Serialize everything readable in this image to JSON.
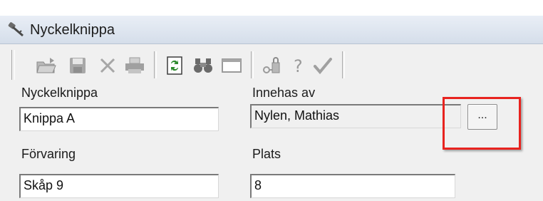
{
  "window": {
    "title": "Nyckelknippa",
    "icon": "key-icon"
  },
  "toolbar": {
    "buttons": [
      {
        "name": "open-folder-icon"
      },
      {
        "name": "save-icon"
      },
      {
        "name": "delete-icon"
      },
      {
        "name": "print-icon"
      },
      {
        "name": "refresh-icon"
      },
      {
        "name": "binoculars-icon"
      },
      {
        "name": "window-icon"
      },
      {
        "name": "key-lock-icon"
      },
      {
        "name": "help-icon"
      },
      {
        "name": "checkmark-icon"
      }
    ]
  },
  "form": {
    "nyckelknippa": {
      "label": "Nyckelknippa",
      "value": "Knippa A"
    },
    "innehas_av": {
      "label": "Innehas av",
      "value": "Nylen, Mathias",
      "browse_label": "..."
    },
    "forvaring": {
      "label": "Förvaring",
      "value": "Skåp 9"
    },
    "plats": {
      "label": "Plats",
      "value": "8"
    }
  },
  "annotation": {
    "color": "#e8231f"
  }
}
